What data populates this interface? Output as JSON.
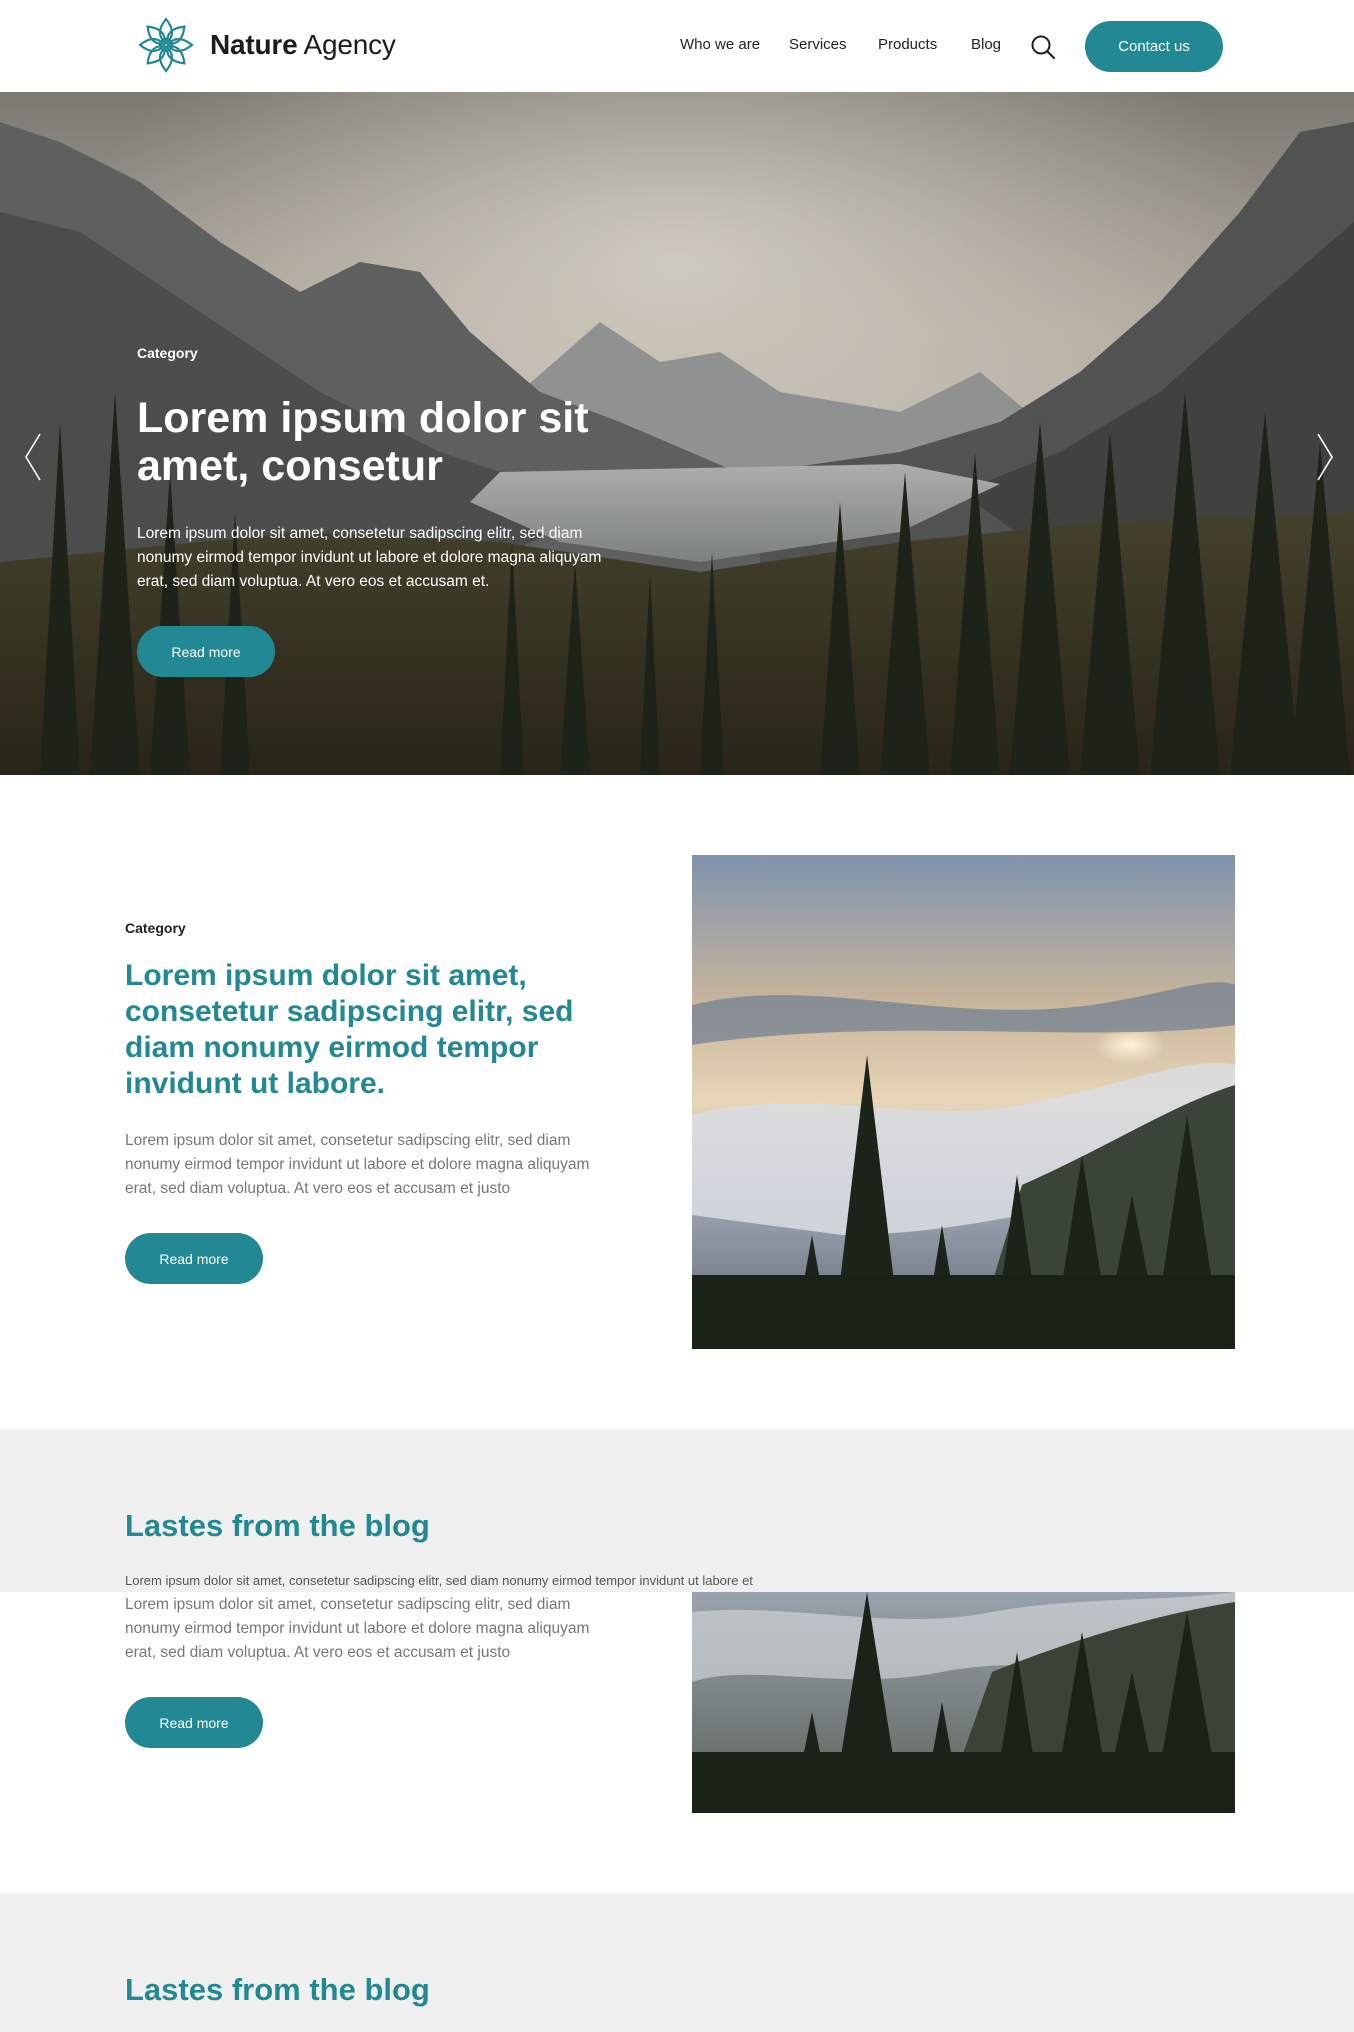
{
  "header": {
    "brand_bold": "Nature",
    "brand_light": " Agency",
    "nav": [
      "Who we are",
      "Services",
      "Products",
      "Blog"
    ],
    "contact_label": "Contact us"
  },
  "hero": {
    "category": "Category",
    "title": "Lorem ipsum dolor sit amet, consetur",
    "text": "Lorem ipsum dolor sit amet, consetetur sadipscing elitr, sed diam nonumy eirmod tempor invidunt ut labore et dolore magna aliquyam erat, sed diam voluptua. At vero eos et accusam et.",
    "button": "Read more"
  },
  "feature": {
    "category": "Category",
    "title": "Lorem ipsum dolor sit amet, consetetur sadipscing elitr, sed diam nonumy eirmod tempor invidunt ut labore.",
    "text": "Lorem ipsum dolor sit amet, consetetur sadipscing elitr, sed diam nonumy eirmod tempor invidunt ut labore et dolore magna aliquyam erat, sed diam voluptua. At vero eos et accusam et justo",
    "button": "Read more"
  },
  "blog": {
    "title": "Lastes from the blog",
    "subtitle": "Lorem ipsum dolor sit amet, consetetur sadipscing elitr, sed diam nonumy eirmod tempor invidunt ut labore et"
  },
  "repeat": {
    "text": "Lorem ipsum dolor sit amet, consetetur sadipscing elitr, sed diam nonumy eirmod tempor invidunt ut labore et dolore magna aliquyam erat, sed diam voluptua. At vero eos et accusam et justo",
    "button": "Read more"
  },
  "blog2": {
    "title": "Lastes from the blog"
  },
  "colors": {
    "accent": "#228893",
    "band": "#f0f0f0"
  },
  "icons": [
    "logo-flower-icon",
    "search-icon",
    "chevron-left-icon",
    "chevron-right-icon"
  ]
}
